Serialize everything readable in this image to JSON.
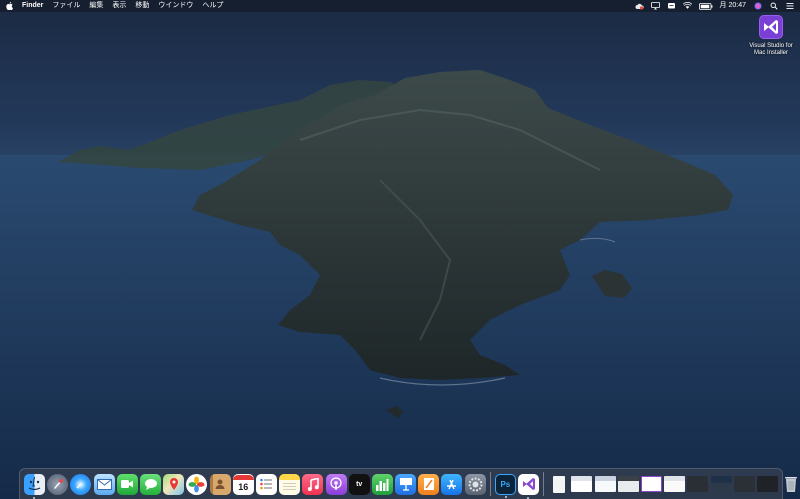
{
  "menubar": {
    "app_name": "Finder",
    "items": [
      "ファイル",
      "編集",
      "表示",
      "移動",
      "ウインドウ",
      "ヘルプ"
    ],
    "clock": "月 20:47",
    "status_icons": [
      "creative-cloud-icon",
      "airplay-icon",
      "input-menu-icon",
      "wifi-icon",
      "battery-icon",
      "siri-icon",
      "spotlight-search-icon",
      "notification-center-icon"
    ]
  },
  "desktop": {
    "icons": [
      {
        "label_line1": "Visual Studio for",
        "label_line2": "Mac Installer",
        "icon": "visual-studio-installer-icon"
      }
    ]
  },
  "dock": {
    "apps": [
      {
        "name": "finder",
        "running": true
      },
      {
        "name": "launchpad",
        "running": false
      },
      {
        "name": "safari",
        "running": false
      },
      {
        "name": "mail",
        "running": false
      },
      {
        "name": "facetime",
        "running": false
      },
      {
        "name": "messages",
        "running": false
      },
      {
        "name": "maps",
        "running": false
      },
      {
        "name": "photos",
        "running": false
      },
      {
        "name": "contacts",
        "running": false
      },
      {
        "name": "calendar",
        "running": false,
        "text": "16"
      },
      {
        "name": "reminders",
        "running": false
      },
      {
        "name": "notes",
        "running": false
      },
      {
        "name": "music",
        "running": false
      },
      {
        "name": "podcasts",
        "running": false
      },
      {
        "name": "apple-tv",
        "running": false,
        "text": "tv"
      },
      {
        "name": "numbers",
        "running": false
      },
      {
        "name": "keynote",
        "running": false
      },
      {
        "name": "pages",
        "running": false
      },
      {
        "name": "app-store",
        "running": false
      },
      {
        "name": "system-preferences",
        "running": false
      },
      {
        "name": "photoshop",
        "running": true,
        "text": "Ps"
      },
      {
        "name": "visual-studio",
        "running": true
      }
    ],
    "minimized_count": 11,
    "colors": {
      "finder": "#2b8ef0",
      "photoshop": "#0d2338",
      "photoshop_text": "#36a8ff",
      "visual_studio": "#8a4ad0"
    }
  }
}
